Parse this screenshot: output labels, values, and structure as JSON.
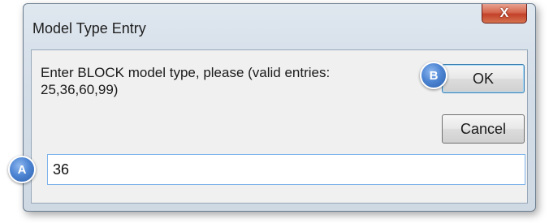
{
  "window": {
    "title": "Model Type Entry",
    "close_label": "X"
  },
  "prompt": {
    "text": "Enter BLOCK model type, please (valid entries: 25,36,60,99)"
  },
  "buttons": {
    "ok_label": "OK",
    "cancel_label": "Cancel"
  },
  "input": {
    "value": "36"
  },
  "callouts": {
    "a_label": "A",
    "b_label": "B"
  },
  "colors": {
    "accent": "#4f86d4",
    "close_button": "#c2412a",
    "focus_border": "#7eb4ea"
  }
}
